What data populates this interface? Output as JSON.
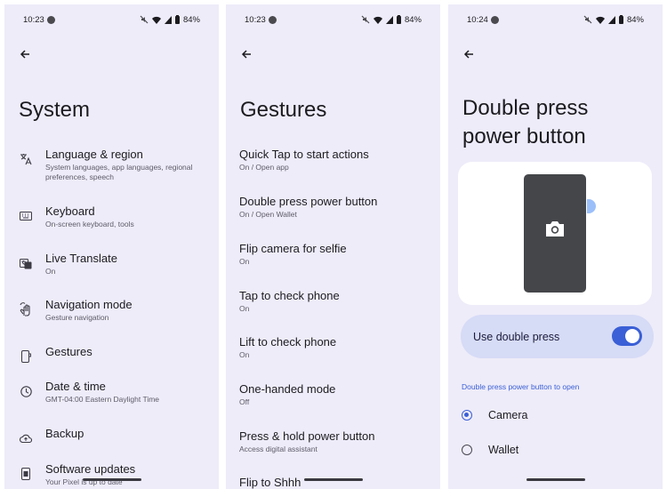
{
  "panels": [
    {
      "status": {
        "time": "10:23",
        "battery": "84%"
      },
      "title": "System",
      "items": [
        {
          "title": "Language & region",
          "subtitle": "System languages, app languages, regional preferences, speech",
          "icon": "translate-icon"
        },
        {
          "title": "Keyboard",
          "subtitle": "On-screen keyboard, tools",
          "icon": "keyboard-icon"
        },
        {
          "title": "Live Translate",
          "subtitle": "On",
          "icon": "live-translate-icon"
        },
        {
          "title": "Navigation mode",
          "subtitle": "Gesture navigation",
          "icon": "gesture-hand-icon"
        },
        {
          "title": "Gestures",
          "subtitle": "",
          "icon": "phone-gesture-icon"
        },
        {
          "title": "Date & time",
          "subtitle": "GMT-04:00 Eastern Daylight Time",
          "icon": "clock-icon"
        },
        {
          "title": "Backup",
          "subtitle": "",
          "icon": "cloud-upload-icon"
        },
        {
          "title": "Software updates",
          "subtitle": "Your Pixel is up to date",
          "icon": "system-update-icon"
        }
      ]
    },
    {
      "status": {
        "time": "10:23",
        "battery": "84%"
      },
      "title": "Gestures",
      "items": [
        {
          "title": "Quick Tap to start actions",
          "subtitle": "On / Open app"
        },
        {
          "title": "Double press power button",
          "subtitle": "On / Open Wallet"
        },
        {
          "title": "Flip camera for selfie",
          "subtitle": "On"
        },
        {
          "title": "Tap to check phone",
          "subtitle": "On"
        },
        {
          "title": "Lift to check phone",
          "subtitle": "On"
        },
        {
          "title": "One-handed mode",
          "subtitle": "Off"
        },
        {
          "title": "Press & hold power button",
          "subtitle": "Access digital assistant"
        },
        {
          "title": "Flip to Shhh",
          "subtitle": ""
        }
      ]
    },
    {
      "status": {
        "time": "10:24",
        "battery": "84%"
      },
      "title": "Double press power button",
      "toggle": {
        "label": "Use double press",
        "on": true
      },
      "section_header": "Double press power button to open",
      "options": [
        {
          "label": "Camera",
          "selected": true
        },
        {
          "label": "Wallet",
          "selected": false
        }
      ]
    }
  ],
  "colors": {
    "background": "#eeecf9",
    "accent": "#3a5fd6",
    "toggle_card": "#d6dbf6"
  }
}
